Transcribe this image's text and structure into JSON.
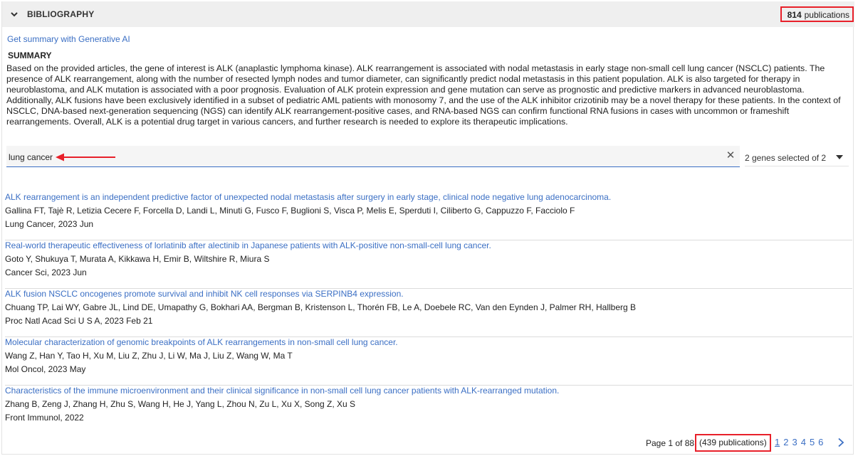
{
  "header": {
    "title": "BIBLIOGRAPHY",
    "count_number": "814",
    "count_label": "publications"
  },
  "summary": {
    "link_label": "Get summary with Generative AI",
    "heading": "SUMMARY",
    "text": "Based on the provided articles, the gene of interest is ALK (anaplastic lymphoma kinase). ALK rearrangement is associated with nodal metastasis in early stage non-small cell lung cancer (NSCLC) patients. The presence of ALK rearrangement, along with the number of resected lymph nodes and tumor diameter, can significantly predict nodal metastasis in this patient population. ALK is also targeted for therapy in neuroblastoma, and ALK mutation is associated with a poor prognosis. Evaluation of ALK protein expression and gene mutation can serve as prognostic and predictive markers in advanced neuroblastoma. Additionally, ALK fusions have been exclusively identified in a subset of pediatric AML patients with monosomy 7, and the use of the ALK inhibitor crizotinib may be a novel therapy for these patients. In the context of NSCLC, DNA-based next-generation sequencing (NGS) can identify ALK rearrangement-positive cases, and RNA-based NGS can confirm functional RNA fusions in cases with uncommon or frameshift rearrangements. Overall, ALK is a potential drug target in various cancers, and further research is needed to explore its therapeutic implications."
  },
  "search": {
    "value": "lung cancer",
    "placeholder": ""
  },
  "genes_filter": {
    "label": "2 genes selected of 2"
  },
  "articles": [
    {
      "title": "ALK rearrangement is an independent predictive factor of unexpected nodal metastasis after surgery in early stage, clinical node negative lung adenocarcinoma.",
      "authors": "Gallina FT,  Tajè R,  Letizia Cecere F,  Forcella D,  Landi L,  Minuti G,  Fusco F,  Buglioni S,  Visca P,  Melis E,  Sperduti I,  Ciliberto G,  Cappuzzo F,  Facciolo F",
      "journal": "Lung Cancer,  2023 Jun"
    },
    {
      "title": "Real-world therapeutic effectiveness of lorlatinib after alectinib in Japanese patients with ALK-positive non-small-cell lung cancer.",
      "authors": "Goto Y,  Shukuya T,  Murata A,  Kikkawa H,  Emir B,  Wiltshire R,  Miura S",
      "journal": "Cancer Sci,  2023 Jun"
    },
    {
      "title": "ALK fusion NSCLC oncogenes promote survival and inhibit NK cell responses via SERPINB4 expression.",
      "authors": "Chuang TP,  Lai WY,  Gabre JL,  Lind DE,  Umapathy G,  Bokhari AA,  Bergman B,  Kristenson L,  Thorén FB,  Le A,  Doebele RC,  Van den Eynden J,  Palmer RH,  Hallberg B",
      "journal": "Proc Natl Acad Sci U S A,  2023 Feb 21"
    },
    {
      "title": "Molecular characterization of genomic breakpoints of ALK rearrangements in non-small cell lung cancer.",
      "authors": "Wang Z,  Han Y,  Tao H,  Xu M,  Liu Z,  Zhu J,  Li W,  Ma J,  Liu Z,  Wang W,  Ma T",
      "journal": "Mol Oncol,  2023 May"
    },
    {
      "title": "Characteristics of the immune microenvironment and their clinical significance in non-small cell lung cancer patients with ALK-rearranged mutation.",
      "authors": "Zhang B,  Zeng J,  Zhang H,  Zhu S,  Wang H,  He J,  Yang L,  Zhou N,  Zu L,  Xu X,  Song Z,  Xu S",
      "journal": "Front Immunol,  2022"
    }
  ],
  "pagination": {
    "info": "Page 1 of 88",
    "count": "(439 publications)",
    "pages": [
      "1",
      "2",
      "3",
      "4",
      "5",
      "6"
    ]
  },
  "colors": {
    "link": "#3b6fc4",
    "highlight_box": "#e8202a",
    "header_bg": "#efefef"
  },
  "icons": {
    "collapse": "chevron-down-icon",
    "clear": "close-icon",
    "dropdown": "caret-down-icon",
    "next": "chevron-right-icon",
    "annotation": "red-arrow-icon"
  }
}
